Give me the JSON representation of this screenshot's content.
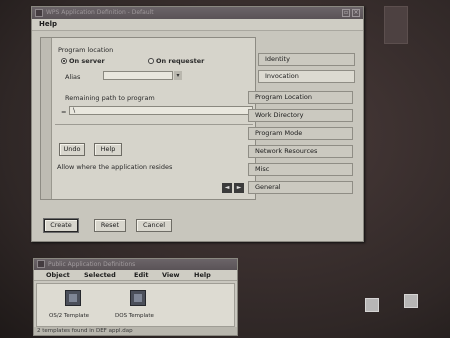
{
  "main_window": {
    "title": "WPS Application Definition - Default",
    "close_glyph": "×",
    "minimize_glyph": "▫",
    "menu": {
      "help_label": "Help"
    }
  },
  "form": {
    "program_location_label": "Program location",
    "on_server_label": "On server",
    "on_requester_label": "On requester",
    "on_server_selected": true,
    "alias_label": "Alias",
    "alias_value": "",
    "remaining_path_label": "Remaining path to program",
    "path_value": "\\",
    "path_prefix": "=",
    "undo_label": "Undo",
    "help_label": "Help",
    "status_text": "Allow where the application resides",
    "nav_prev_glyph": "◄",
    "nav_next_glyph": "►"
  },
  "tabs": [
    {
      "label": "Identity",
      "active": false
    },
    {
      "label": "Invocation",
      "active": true
    },
    {
      "label": "Program Location",
      "active": false
    },
    {
      "label": "Work Directory",
      "active": false
    },
    {
      "label": "Program Mode",
      "active": false
    },
    {
      "label": "Network Resources",
      "active": false
    },
    {
      "label": "Misc",
      "active": false
    },
    {
      "label": "General",
      "active": false
    }
  ],
  "footer_buttons": {
    "create_label": "Create",
    "reset_label": "Reset",
    "cancel_label": "Cancel"
  },
  "sub_window": {
    "title": "Public Application Definitions",
    "menu": {
      "object_label": "Object",
      "selected_label": "Selected",
      "edit_label": "Edit",
      "view_label": "View",
      "help_label": "Help"
    },
    "icons": [
      {
        "label": "OS/2 Template",
        "icon": "template-icon"
      },
      {
        "label": "DOS Template",
        "icon": "template-icon"
      }
    ],
    "status_text": "2 templates found in DEF appl.dap"
  }
}
